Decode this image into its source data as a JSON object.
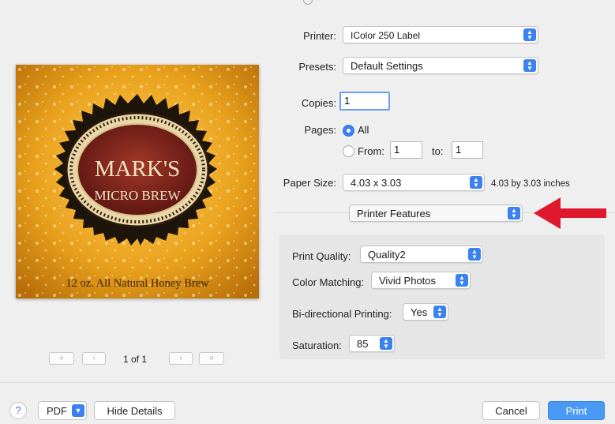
{
  "printer": {
    "label": "Printer:",
    "value": "IColor 250 Label"
  },
  "presets": {
    "label": "Presets:",
    "value": "Default Settings"
  },
  "copies": {
    "label": "Copies:",
    "value": "1"
  },
  "pages": {
    "label": "Pages:",
    "all_label": "All",
    "from_label": "From:",
    "from_value": "1",
    "to_label": "to:",
    "to_value": "1"
  },
  "paper_size": {
    "label": "Paper Size:",
    "value": "4.03 x 3.03",
    "description": "4.03 by 3.03 inches"
  },
  "section": {
    "value": "Printer Features"
  },
  "print_quality": {
    "label": "Print Quality:",
    "value": "Quality2"
  },
  "color_matching": {
    "label": "Color Matching:",
    "value": "Vivid Photos"
  },
  "bidirectional": {
    "label": "Bi-directional Printing:",
    "value": "Yes"
  },
  "saturation": {
    "label": "Saturation:",
    "value": "85"
  },
  "preview": {
    "title_line1": "MARK'S",
    "title_line2": "MICRO BREW",
    "tagline": "12 oz. All Natural Honey Brew",
    "page_indicator": "1 of 1",
    "first_page_icon": "«",
    "prev_page_icon": "‹",
    "next_page_icon": "›",
    "last_page_icon": "»"
  },
  "footer": {
    "help_label": "?",
    "pdf_label": "PDF",
    "hide_details_label": "Hide Details",
    "cancel_label": "Cancel",
    "print_label": "Print"
  },
  "colors": {
    "accent": "#3b82f0",
    "annotation_arrow": "#e0182d",
    "label_gold": "#e8a21a",
    "label_maroon": "#7a2418"
  },
  "icons": {
    "popup_arrows": "stepper-arrows-icon",
    "annotation": "red-arrow-icon",
    "pdf_menu": "chevron-down-icon"
  }
}
